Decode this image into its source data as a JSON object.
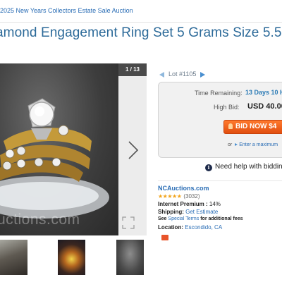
{
  "breadcrumb": "2025 New Years Collectors Estate Sale Auction",
  "listing_title": "amond Engagement Ring Set 5 Grams Size 5.5",
  "gallery": {
    "counter": "1 / 13",
    "watermark": "uctions.com",
    "thumbnails": [
      "photo-2",
      "photo-3",
      "photo-4"
    ]
  },
  "lot": {
    "number": "Lot #1105"
  },
  "bidding": {
    "time_remaining_label": "Time Remaining:",
    "time_remaining_value": "13 Days 10 H",
    "high_bid_label": "High Bid:",
    "high_bid_value": "USD 40.00",
    "bid_button": "BID NOW $4",
    "or_text": "or",
    "max_bid_link": "Enter a maximum",
    "help_text": "Need help with bidding"
  },
  "seller": {
    "name": "NCAuctions.com",
    "stars": "★★★★★",
    "rating_count": "(3032)",
    "premium_label": "Internet Premium :",
    "premium_value": "14%",
    "shipping_label": "Shipping:",
    "shipping_link": "Get Estimate",
    "terms_see": "See",
    "terms_link": "Special Terms",
    "terms_suffix": "for additional fees",
    "location_label": "Location:",
    "location_value": "Escondido, CA"
  },
  "colors": {
    "link_blue": "#2a6db5",
    "title_blue": "#2c6a99",
    "bid_orange": "#e8551a",
    "star_gold": "#f2a31a"
  },
  "icons": [
    "prev-lot-arrow-icon",
    "next-lot-arrow-icon",
    "next-image-chevron-icon",
    "fullscreen-icon",
    "hammer-icon",
    "info-circle-icon",
    "star-rating-icon",
    "badge-icon"
  ]
}
